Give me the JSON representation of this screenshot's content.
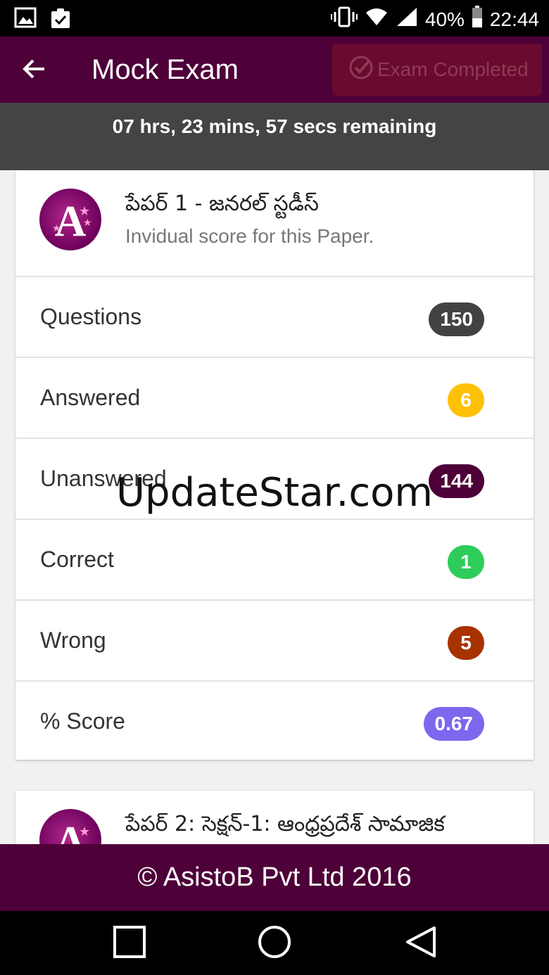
{
  "status_bar": {
    "battery": "40%",
    "time": "22:44",
    "icons": [
      "image-icon",
      "clipboard-check-icon",
      "vibrate-icon",
      "wifi-icon",
      "signal-icon",
      "battery-icon"
    ]
  },
  "app_bar": {
    "title": "Mock Exam",
    "completed_label": "Exam Completed",
    "back_icon": "back-arrow-icon"
  },
  "timer": {
    "text": "07 hrs, 23 mins, 57 secs remaining"
  },
  "paper1": {
    "title": "పేపర్ 1 - జనరల్ స్టడీస్",
    "subtitle": "Invidual score for this Paper.",
    "rows": [
      {
        "label": "Questions",
        "value": "150",
        "color": "#424242"
      },
      {
        "label": "Answered",
        "value": "6",
        "color": "#ffc107"
      },
      {
        "label": "Unanswered",
        "value": "144",
        "color": "#4e0039"
      },
      {
        "label": "Correct",
        "value": "1",
        "color": "#2ecc5a"
      },
      {
        "label": "Wrong",
        "value": "5",
        "color": "#a83200"
      },
      {
        "label": "% Score",
        "value": "0.67",
        "color": "#7b68ee"
      }
    ]
  },
  "paper2": {
    "title": "పేపర్ 2: సెక్షన్-1: ఆంధ్రప్రదేశ్ సామాజిక"
  },
  "watermark": "UpdateStar.com",
  "footer": {
    "text": "© AsistoB Pvt Ltd 2016"
  },
  "nav_bar": {
    "buttons": [
      "recents-icon",
      "home-icon",
      "back-icon"
    ]
  }
}
